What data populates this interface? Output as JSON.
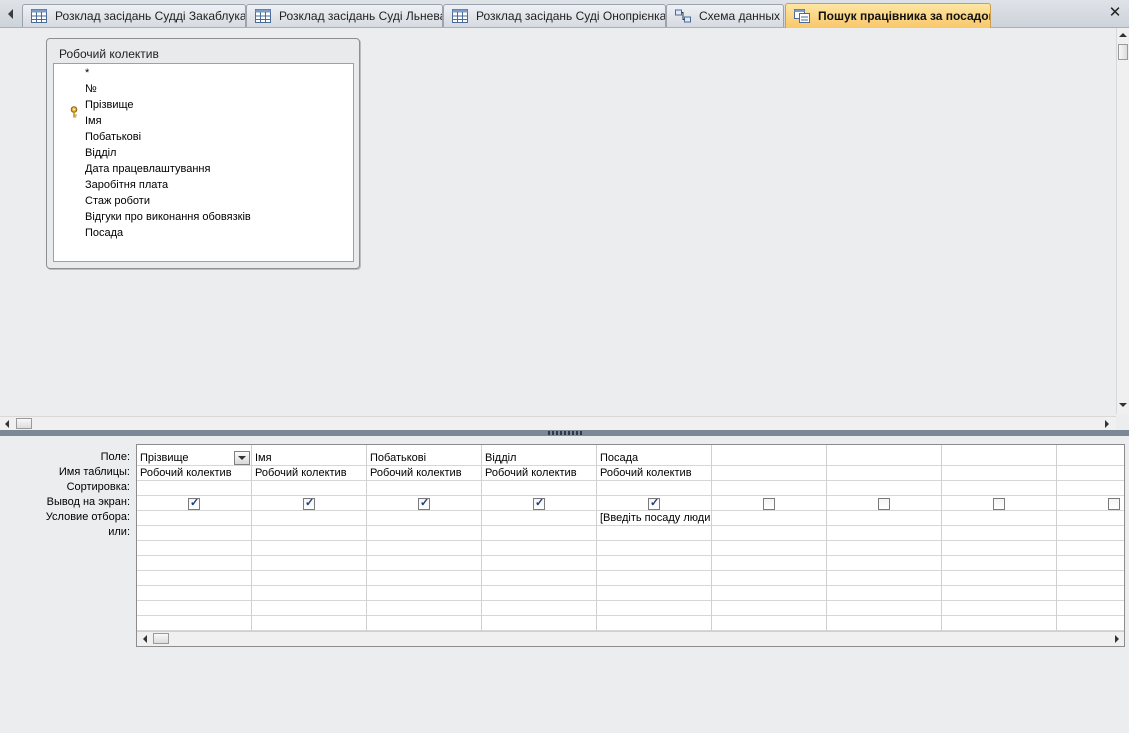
{
  "tabs": [
    {
      "label": "Розклад засідань Судді Закаблука",
      "icon": "table-icon",
      "active": false
    },
    {
      "label": "Розклад засідань Суді Льнева",
      "icon": "table-icon",
      "active": false
    },
    {
      "label": "Розклад засідань Суді Онопрієнка",
      "icon": "table-icon",
      "active": false
    },
    {
      "label": "Схема данных",
      "icon": "relationships-icon",
      "active": false
    },
    {
      "label": "Пошук працівника за посадою",
      "icon": "query-icon",
      "active": true
    }
  ],
  "table_box": {
    "title": "Робочий колектив",
    "fields": [
      "*",
      "№",
      "Прізвище",
      "Імя",
      "Побатькові",
      "Відділ",
      "Дата працевлаштування",
      "Заробітня плата",
      "Стаж роботи",
      "Відгуки про виконання обовязків",
      "Посада"
    ],
    "primary_key_field": "№"
  },
  "grid": {
    "row_labels": [
      "Поле:",
      "Имя таблицы:",
      "Сортировка:",
      "Вывод на экран:",
      "Условие отбора:",
      "или:"
    ],
    "columns": [
      {
        "field": "Прізвище",
        "table": "Робочий колектив",
        "sort": "",
        "show": true,
        "criteria": ""
      },
      {
        "field": "Імя",
        "table": "Робочий колектив",
        "sort": "",
        "show": true,
        "criteria": ""
      },
      {
        "field": "Побатькові",
        "table": "Робочий колектив",
        "sort": "",
        "show": true,
        "criteria": ""
      },
      {
        "field": "Відділ",
        "table": "Робочий колектив",
        "sort": "",
        "show": true,
        "criteria": ""
      },
      {
        "field": "Посада",
        "table": "Робочий колектив",
        "sort": "",
        "show": true,
        "criteria": "[Введіть посаду люди"
      },
      {
        "field": "",
        "table": "",
        "sort": "",
        "show": false,
        "criteria": ""
      },
      {
        "field": "",
        "table": "",
        "sort": "",
        "show": false,
        "criteria": ""
      },
      {
        "field": "",
        "table": "",
        "sort": "",
        "show": false,
        "criteria": ""
      },
      {
        "field": "",
        "table": "",
        "sort": "",
        "show": false,
        "criteria": ""
      }
    ]
  },
  "colors": {
    "active_tab": "#f9c76a",
    "splitter": "#7c8896"
  }
}
